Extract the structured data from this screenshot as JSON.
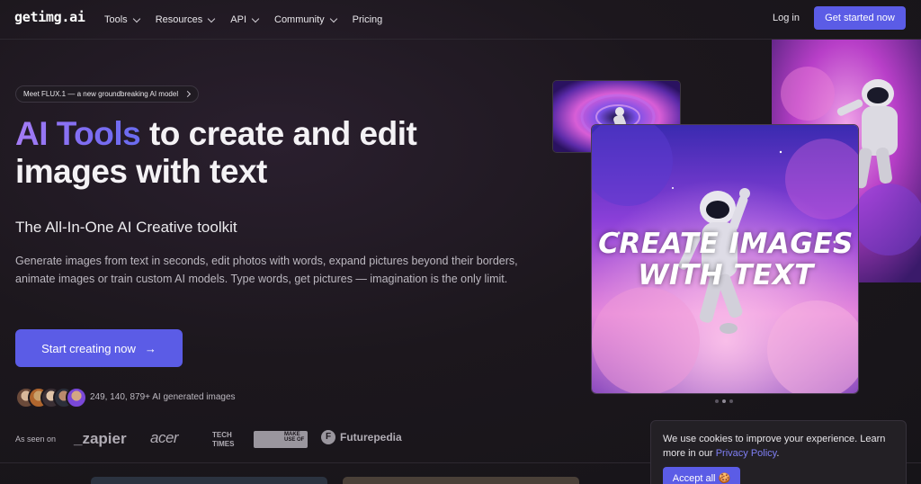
{
  "nav": {
    "logo": "getimg.ai",
    "items": [
      {
        "label": "Tools",
        "dropdown": true
      },
      {
        "label": "Resources",
        "dropdown": true
      },
      {
        "label": "API",
        "dropdown": true
      },
      {
        "label": "Community",
        "dropdown": true
      },
      {
        "label": "Pricing",
        "dropdown": false
      }
    ],
    "login": "Log in",
    "get_started": "Get started now"
  },
  "hero": {
    "badge": "Meet FLUX.1 — a new groundbreaking AI model",
    "headline_accent": "AI Tools",
    "headline_rest_1": " to create and edit",
    "headline_rest_2": "images with text",
    "subhead": "The All-In-One AI Creative toolkit",
    "desc": "Generate images from text in seconds, edit photos with words, expand pictures beyond their borders, animate images or train custom AI models. Type words, get pictures — imagination is the only limit.",
    "cta": "Start creating now",
    "cta_arrow": "→",
    "count_text": "249, 140, 879+ AI generated images",
    "seen_label": "As seen on",
    "press": [
      "_zapier",
      "acer",
      "TECH TIMES",
      "MAKE USE OF",
      "Futurepedia"
    ]
  },
  "showcase": {
    "main_text_line1": "CREATE IMAGES",
    "main_text_line2": "WITH TEXT",
    "carousel_count": 3,
    "carousel_active": 1
  },
  "cookie": {
    "text_before": "We use cookies to improve your experience. Learn more in our ",
    "link": "Privacy Policy",
    "text_after": ".",
    "accept": "Accept all 🍪"
  },
  "colors": {
    "accent": "#5b5ce6",
    "background": "#1c171d"
  }
}
